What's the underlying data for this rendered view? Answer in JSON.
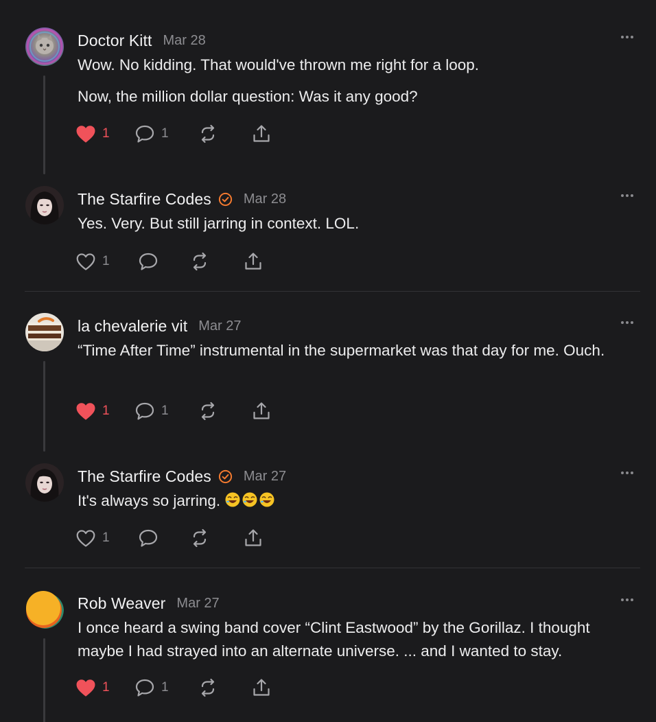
{
  "colors": {
    "background": "#1b1b1d",
    "liked": "#f0525a",
    "verified": "#f47a2f",
    "muted": "#8d8d91",
    "divider": "#333336"
  },
  "icons": {
    "like": "heart-icon",
    "comment": "speech-bubble-icon",
    "restack": "restack-icon",
    "share": "share-icon",
    "more": "ellipsis-icon",
    "verified": "verified-badge-icon"
  },
  "comments": [
    {
      "author": "Doctor Kitt",
      "date": "Mar 28",
      "verified": false,
      "paragraphs": [
        "Wow. No kidding. That would've thrown me right for a loop.",
        "Now, the million dollar question: Was it any good?"
      ],
      "likes": "1",
      "liked": true,
      "replies": "1"
    },
    {
      "author": "The Starfire Codes",
      "date": "Mar 28",
      "verified": true,
      "paragraphs": [
        "Yes. Very. But still jarring in context. LOL."
      ],
      "likes": "1",
      "liked": false,
      "replies": ""
    },
    {
      "author": "la chevalerie vit",
      "date": "Mar 27",
      "verified": false,
      "paragraphs": [
        "“Time After Time” instrumental in the supermarket was that day for me. Ouch."
      ],
      "likes": "1",
      "liked": true,
      "replies": "1"
    },
    {
      "author": "The Starfire Codes",
      "date": "Mar 27",
      "verified": true,
      "paragraphs": [
        "It's always so jarring."
      ],
      "emoji_count": "3",
      "likes": "1",
      "liked": false,
      "replies": ""
    },
    {
      "author": "Rob Weaver",
      "date": "Mar 27",
      "verified": false,
      "paragraphs": [
        "I once heard a swing band cover “Clint Eastwood” by the Gorillaz. I thought maybe I had strayed into an alternate universe. ... and I wanted to stay."
      ],
      "likes": "1",
      "liked": true,
      "replies": "1"
    }
  ]
}
